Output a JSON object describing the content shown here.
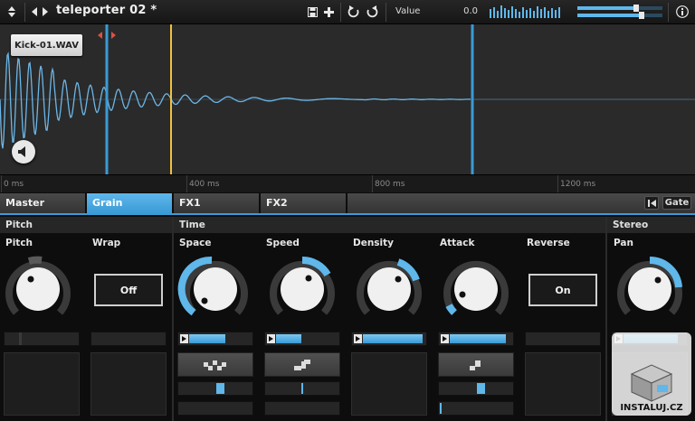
{
  "header": {
    "preset_name": "teleporter 02 *",
    "param_name": "Value",
    "param_value": "0.0",
    "icons": [
      "grip-icon",
      "prev-next-icon",
      "save-icon",
      "add-icon",
      "undo-icon",
      "redo-icon",
      "info-icon"
    ]
  },
  "waveform": {
    "sample_name": "Kick-01.WAV",
    "ruler_labels": [
      "0 ms",
      "400 ms",
      "800 ms",
      "1200 ms"
    ],
    "colors": {
      "wave": "#6cb6e6",
      "marker": "#3a9bd6",
      "playhead": "#f0c040",
      "background": "#2a2a2a"
    }
  },
  "tabs": {
    "items": [
      {
        "label": "Master",
        "active": false
      },
      {
        "label": "Grain",
        "active": true
      },
      {
        "label": "FX1",
        "active": false
      },
      {
        "label": "FX2",
        "active": false
      }
    ],
    "gate_label": "Gate"
  },
  "groups": {
    "pitch": "Pitch",
    "time": "Time",
    "stereo": "Stereo"
  },
  "controls": {
    "pitch": {
      "label": "Pitch"
    },
    "wrap": {
      "label": "Wrap",
      "value": "Off"
    },
    "space": {
      "label": "Space"
    },
    "speed": {
      "label": "Speed"
    },
    "density": {
      "label": "Density"
    },
    "attack": {
      "label": "Attack"
    },
    "reverse": {
      "label": "Reverse",
      "value": "On"
    },
    "pan": {
      "label": "Pan"
    }
  },
  "watermark": {
    "text": "INSTALUJ.CZ"
  }
}
